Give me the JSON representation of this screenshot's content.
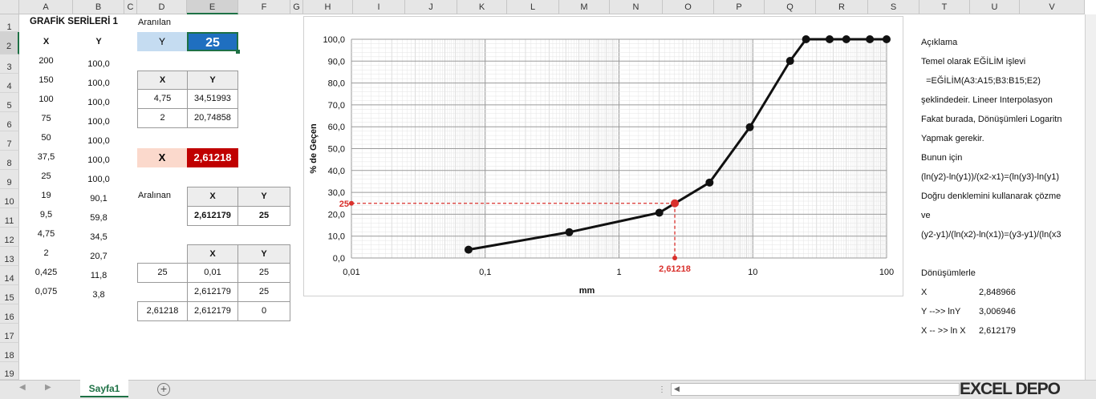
{
  "columns": [
    "A",
    "B",
    "C",
    "D",
    "E",
    "F",
    "G",
    "H",
    "I",
    "J",
    "K",
    "L",
    "M",
    "N",
    "O",
    "P",
    "Q",
    "R",
    "S",
    "T",
    "U",
    "V"
  ],
  "rows": [
    "1",
    "2",
    "3",
    "4",
    "5",
    "6",
    "7",
    "8",
    "9",
    "10",
    "11",
    "12",
    "13",
    "14",
    "15",
    "16",
    "17",
    "18",
    "19"
  ],
  "series": {
    "title": "GRAFİK SERİLERİ 1",
    "x_header": "X",
    "y_header": "Y",
    "x": [
      "200",
      "150",
      "100",
      "75",
      "50",
      "37,5",
      "25",
      "19",
      "9,5",
      "4,75",
      "2",
      "0,425",
      "0,075"
    ],
    "y": [
      "100,0",
      "100,0",
      "100,0",
      "100,0",
      "100,0",
      "100,0",
      "100,0",
      "90,1",
      "59,8",
      "34,5",
      "20,7",
      "11,8",
      "3,8"
    ]
  },
  "lookup": {
    "label": "Aranılan",
    "y_label": "Y",
    "y_value": "25",
    "x_label": "X",
    "x_value": "2,61218"
  },
  "table1": {
    "headers": [
      "X",
      "Y"
    ],
    "rows": [
      [
        "4,75",
        "34,51993"
      ],
      [
        "2",
        "20,74858"
      ]
    ]
  },
  "table2": {
    "label": "Aralınan",
    "headers": [
      "X",
      "Y"
    ],
    "row": [
      "2,612179",
      "25"
    ]
  },
  "table3": {
    "headers": [
      "X",
      "Y"
    ],
    "rows": [
      [
        "25",
        "0,01",
        "25"
      ],
      [
        "",
        "2,612179",
        "25"
      ],
      [
        "2,61218",
        "2,612179",
        "0"
      ]
    ]
  },
  "description": {
    "lines": [
      "Açıklama",
      "Temel olarak EĞİLİM işlevi",
      "  =EĞİLİM(A3:A15;B3:B15;E2)",
      "şeklindedeir. Lineer Interpolasyon",
      "Fakat burada, Dönüşümleri Logaritn",
      "Yapmak gerekir.",
      "Bunun için",
      "(ln(y2)-ln(y1))/(x2-x1)=(ln(y3)-ln(y1)",
      "Doğru denklemini kullanarak çözme",
      "ve",
      "(y2-y1)/(ln(x2)-ln(x1))=(y3-y1)/(ln(x3"
    ],
    "conv_title": "Dönüşümlerle",
    "conv": [
      {
        "label": "X",
        "value": "2,848966"
      },
      {
        "label": "Y -->> lnY",
        "value": "3,006946"
      },
      {
        "label": "X -- >> ln X",
        "value": "2,612179"
      }
    ]
  },
  "sheet_tab": "Sayfa1",
  "add_sheet_icon": "plus-circle-icon",
  "watermark": "EXCEL DEPO",
  "chart_data": {
    "type": "line",
    "x_scale": "log",
    "xlim": [
      0.01,
      100
    ],
    "ylim": [
      0,
      100
    ],
    "x_ticks": [
      "0,01",
      "0,1",
      "1",
      "10",
      "100"
    ],
    "y_ticks": [
      "0,0",
      "10,0",
      "20,0",
      "30,0",
      "40,0",
      "50,0",
      "60,0",
      "70,0",
      "80,0",
      "90,0",
      "100,0"
    ],
    "xlabel": "mm",
    "ylabel": "% de Geçen",
    "grid": true,
    "points": [
      {
        "x": 0.075,
        "y": 3.8
      },
      {
        "x": 0.425,
        "y": 11.8
      },
      {
        "x": 2,
        "y": 20.7
      },
      {
        "x": 4.75,
        "y": 34.5
      },
      {
        "x": 9.5,
        "y": 59.8
      },
      {
        "x": 19,
        "y": 90.1
      },
      {
        "x": 25,
        "y": 100
      },
      {
        "x": 37.5,
        "y": 100
      },
      {
        "x": 50,
        "y": 100
      },
      {
        "x": 75,
        "y": 100
      },
      {
        "x": 100,
        "y": 100
      }
    ],
    "highlight": {
      "x": 2.61218,
      "y": 25,
      "x_label": "2,61218",
      "y_label": "25"
    },
    "line_color": "#111111",
    "highlight_color": "#d9302c"
  }
}
